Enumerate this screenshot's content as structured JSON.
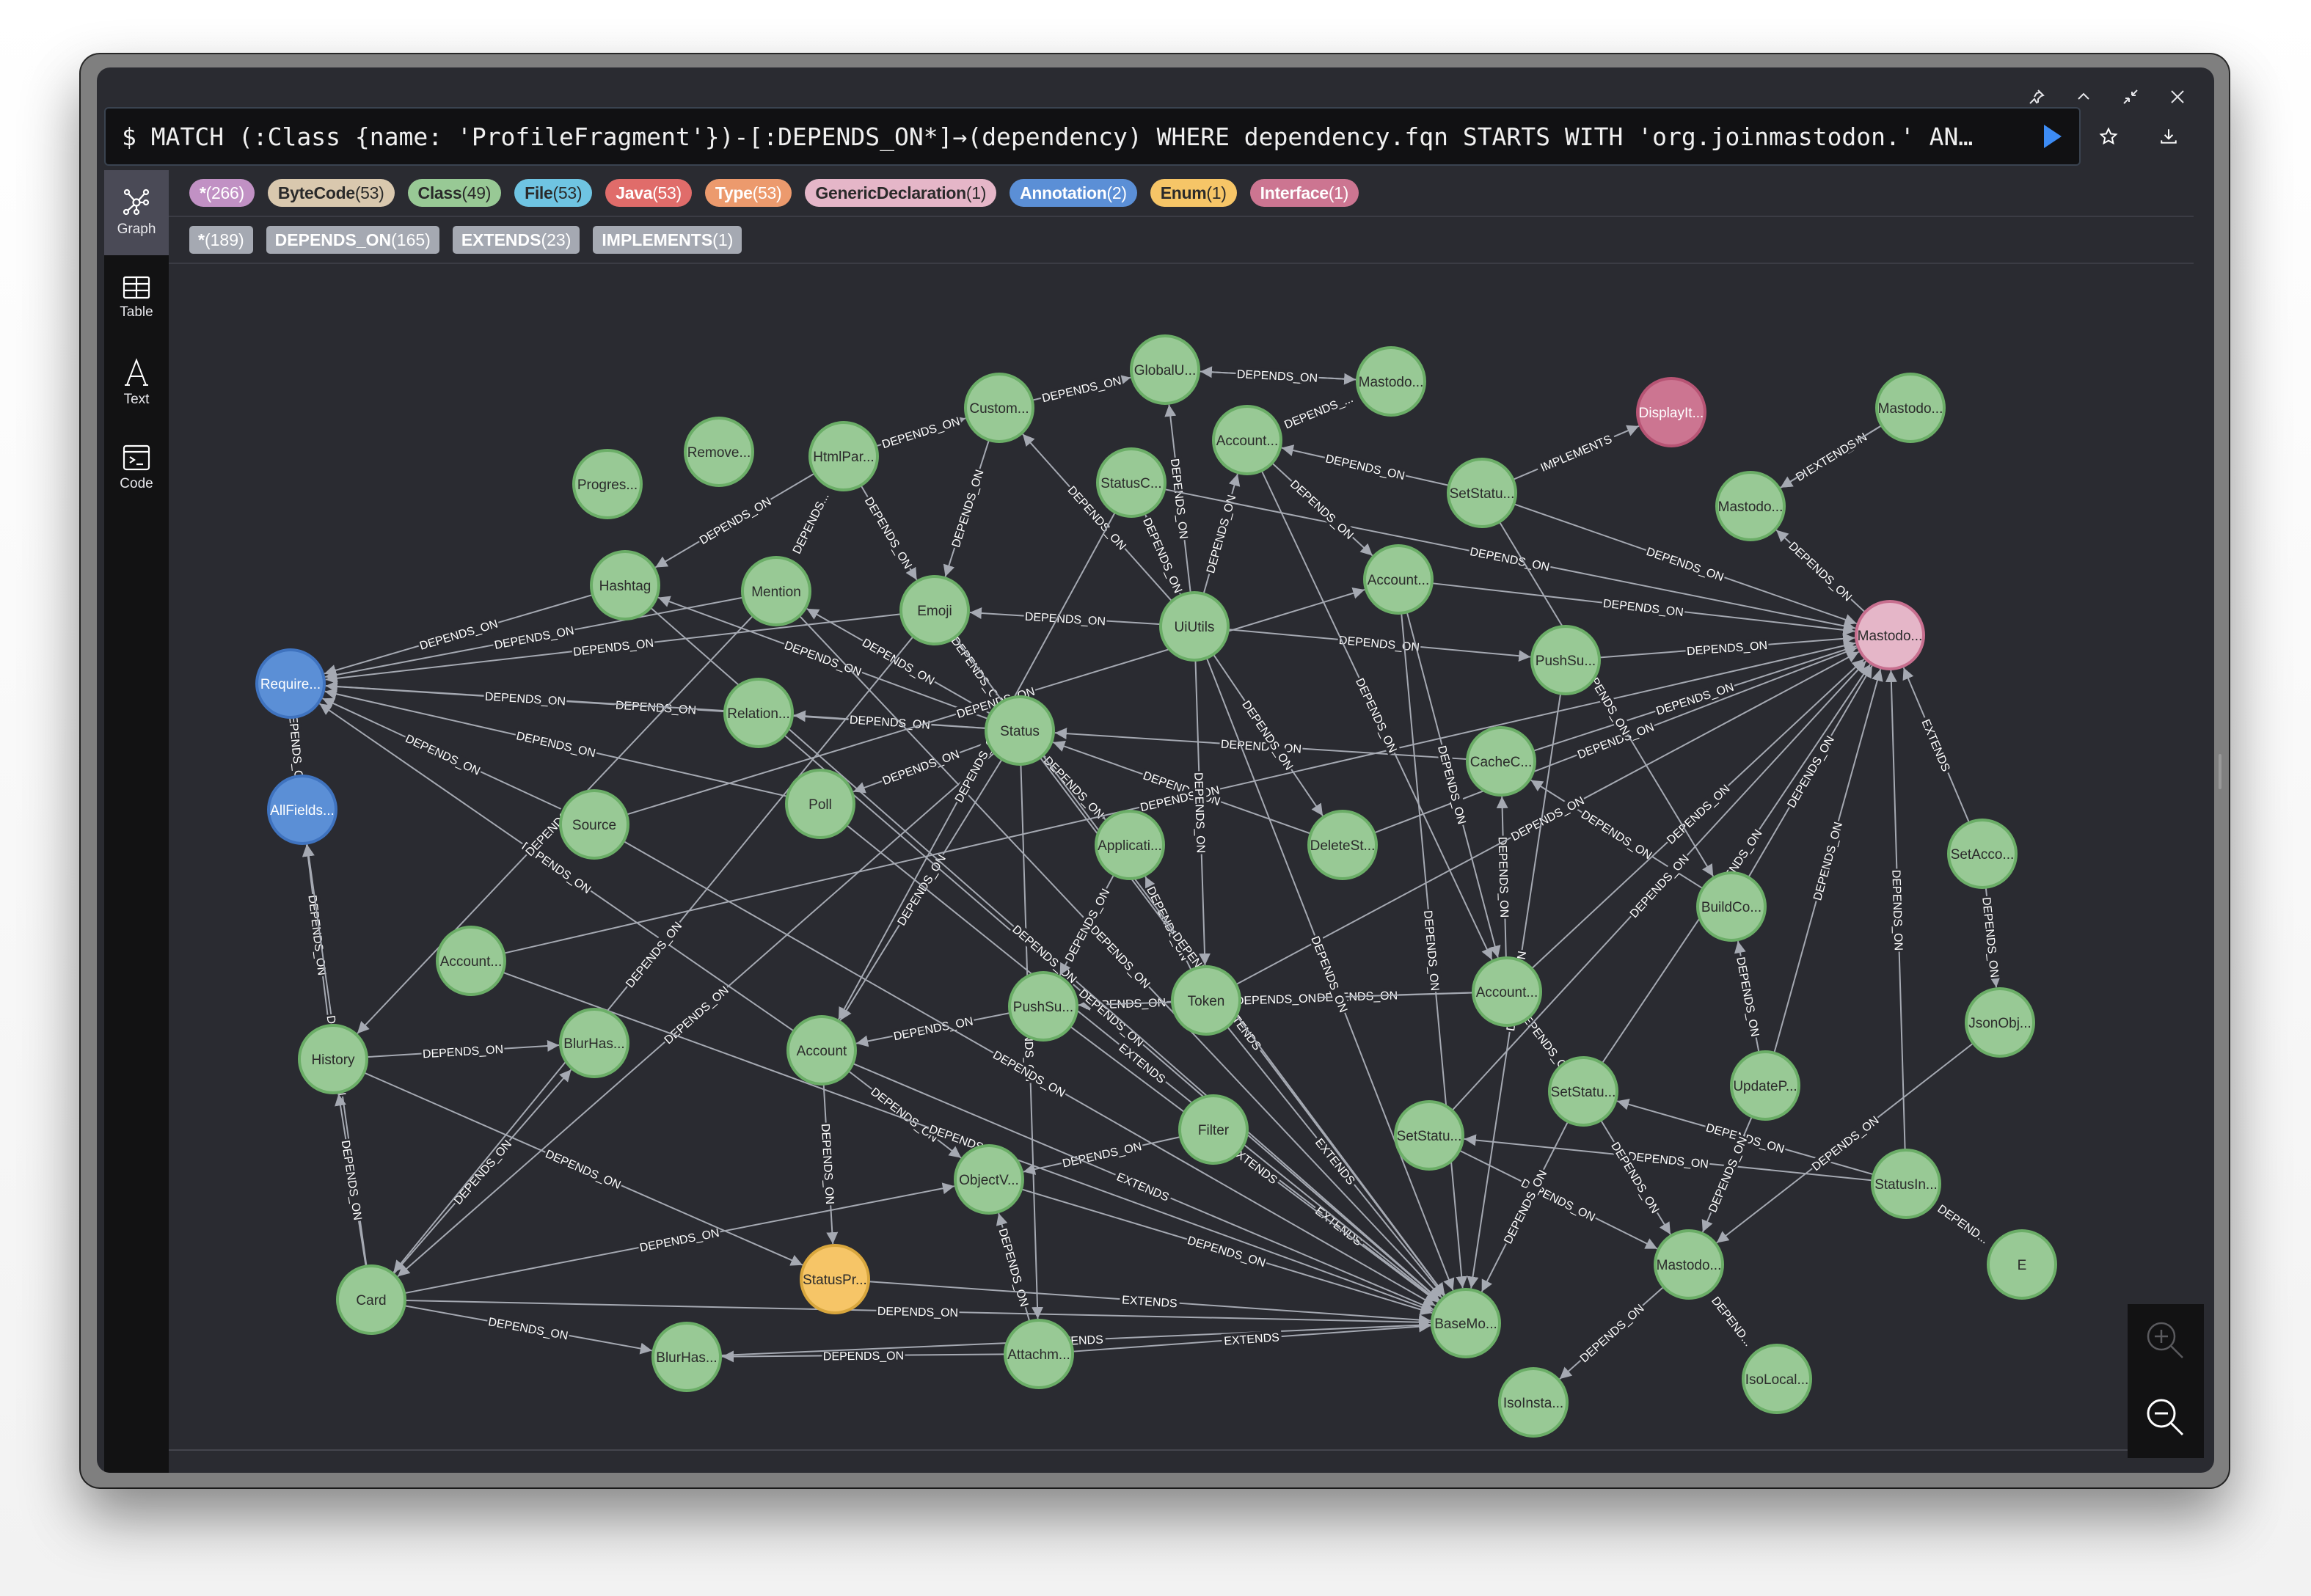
{
  "window_controls": [
    {
      "name": "pin-icon",
      "glyph": "📌"
    },
    {
      "name": "collapse-icon",
      "glyph": "︿"
    },
    {
      "name": "shrink-icon",
      "glyph": "⤡"
    },
    {
      "name": "close-icon",
      "glyph": "✕"
    }
  ],
  "query": {
    "text": "$ MATCH (:Class {name: 'ProfileFragment'})-[:DEPENDS_ON*]→(dependency) WHERE dependency.fqn STARTS WITH 'org.joinmastodon.' AN…",
    "run_icon": "play-icon",
    "favorite_icon": "star-icon",
    "download_icon": "download-icon"
  },
  "sidebar": {
    "items": [
      {
        "label": "Graph",
        "icon": "graph-icon",
        "active": true
      },
      {
        "label": "Table",
        "icon": "table-icon",
        "active": false
      },
      {
        "label": "Text",
        "icon": "text-icon",
        "active": false
      },
      {
        "label": "Code",
        "icon": "code-icon",
        "active": false
      }
    ]
  },
  "node_labels": [
    {
      "label": "*",
      "count": "(266)",
      "bg": "#c191c4",
      "fg": "#ffffff"
    },
    {
      "label": "ByteCode",
      "count": "(53)",
      "bg": "#d9c8ae",
      "fg": "#2a2a2a"
    },
    {
      "label": "Class",
      "count": "(49)",
      "bg": "#98c995",
      "fg": "#2a2a2a"
    },
    {
      "label": "File",
      "count": "(53)",
      "bg": "#6fc4e2",
      "fg": "#2a2a2a"
    },
    {
      "label": "Java",
      "count": "(53)",
      "bg": "#e06c6a",
      "fg": "#ffffff"
    },
    {
      "label": "Type",
      "count": "(53)",
      "bg": "#ec9a6d",
      "fg": "#ffffff"
    },
    {
      "label": "GenericDeclaration",
      "count": "(1)",
      "bg": "#e5b6c8",
      "fg": "#2a2a2a"
    },
    {
      "label": "Annotation",
      "count": "(2)",
      "bg": "#5b8fd6",
      "fg": "#ffffff"
    },
    {
      "label": "Enum",
      "count": "(1)",
      "bg": "#f6c567",
      "fg": "#2a2a2a"
    },
    {
      "label": "Interface",
      "count": "(1)",
      "bg": "#cc7591",
      "fg": "#ffffff"
    }
  ],
  "relationship_types": [
    {
      "label": "*",
      "count": "(189)"
    },
    {
      "label": "DEPENDS_ON",
      "count": "(165)"
    },
    {
      "label": "EXTENDS",
      "count": "(23)"
    },
    {
      "label": "IMPLEMENTS",
      "count": "(1)"
    }
  ],
  "node_styles": {
    "class": {
      "fill": "#98c995",
      "stroke": "#6bae67",
      "text": "#2b2b2b"
    },
    "annotation": {
      "fill": "#5b8fd6",
      "stroke": "#3f73bf",
      "text": "#ffffff"
    },
    "interface": {
      "fill": "#cc7591",
      "stroke": "#b75474",
      "text": "#ffffff"
    },
    "generic": {
      "fill": "#e5b6c8",
      "stroke": "#c86f8f",
      "text": "#2b2b2b"
    },
    "enum": {
      "fill": "#f6c567",
      "stroke": "#d8a63d",
      "text": "#2b2b2b"
    }
  },
  "graph": {
    "nodes": [
      {
        "id": "progres",
        "label": "Progres...",
        "type": "class"
      },
      {
        "id": "remove",
        "label": "Remove...",
        "type": "class"
      },
      {
        "id": "htmlpar",
        "label": "HtmlPar...",
        "type": "class"
      },
      {
        "id": "custom",
        "label": "Custom...",
        "type": "class"
      },
      {
        "id": "globalu",
        "label": "GlobalU...",
        "type": "class"
      },
      {
        "id": "mastodo1",
        "label": "Mastodo...",
        "type": "class"
      },
      {
        "id": "displayit",
        "label": "DisplayIt...",
        "type": "interface"
      },
      {
        "id": "mastodo2",
        "label": "Mastodo...",
        "type": "class"
      },
      {
        "id": "mastodo3",
        "label": "Mastodo...",
        "type": "class"
      },
      {
        "id": "account1",
        "label": "Account...",
        "type": "class"
      },
      {
        "id": "statusc",
        "label": "StatusC...",
        "type": "class"
      },
      {
        "id": "setstatu1",
        "label": "SetStatu...",
        "type": "class"
      },
      {
        "id": "hashtag",
        "label": "Hashtag",
        "type": "class"
      },
      {
        "id": "mention",
        "label": "Mention",
        "type": "class"
      },
      {
        "id": "emoji",
        "label": "Emoji",
        "type": "class"
      },
      {
        "id": "uiutils",
        "label": "UiUtils",
        "type": "class"
      },
      {
        "id": "account2",
        "label": "Account...",
        "type": "class"
      },
      {
        "id": "mastodogen",
        "label": "Mastodo...",
        "type": "generic"
      },
      {
        "id": "pushsu1",
        "label": "PushSu...",
        "type": "class"
      },
      {
        "id": "require",
        "label": "Require...",
        "type": "annotation"
      },
      {
        "id": "relation",
        "label": "Relation...",
        "type": "class"
      },
      {
        "id": "status",
        "label": "Status",
        "type": "class"
      },
      {
        "id": "cachec",
        "label": "CacheC...",
        "type": "class"
      },
      {
        "id": "allfields",
        "label": "AllFields...",
        "type": "annotation"
      },
      {
        "id": "poll",
        "label": "Poll",
        "type": "class"
      },
      {
        "id": "source",
        "label": "Source",
        "type": "class"
      },
      {
        "id": "applicati",
        "label": "Applicati...",
        "type": "class"
      },
      {
        "id": "deletest",
        "label": "DeleteSt...",
        "type": "class"
      },
      {
        "id": "setacco",
        "label": "SetAcco...",
        "type": "class"
      },
      {
        "id": "buildco",
        "label": "BuildCo...",
        "type": "class"
      },
      {
        "id": "account3",
        "label": "Account...",
        "type": "class"
      },
      {
        "id": "pushsu2",
        "label": "PushSu...",
        "type": "class"
      },
      {
        "id": "token",
        "label": "Token",
        "type": "class"
      },
      {
        "id": "account4",
        "label": "Account...",
        "type": "class"
      },
      {
        "id": "jsonobj",
        "label": "JsonObj...",
        "type": "class"
      },
      {
        "id": "history",
        "label": "History",
        "type": "class"
      },
      {
        "id": "blurhas1",
        "label": "BlurHas...",
        "type": "class"
      },
      {
        "id": "account",
        "label": "Account",
        "type": "class"
      },
      {
        "id": "setstatu2",
        "label": "SetStatu...",
        "type": "class"
      },
      {
        "id": "updatep",
        "label": "UpdateP...",
        "type": "class"
      },
      {
        "id": "filter",
        "label": "Filter",
        "type": "class"
      },
      {
        "id": "setstatu3",
        "label": "SetStatu...",
        "type": "class"
      },
      {
        "id": "statusin",
        "label": "StatusIn...",
        "type": "class"
      },
      {
        "id": "objectv",
        "label": "ObjectV...",
        "type": "class"
      },
      {
        "id": "statuspr",
        "label": "StatusPr...",
        "type": "enum"
      },
      {
        "id": "mastodo4",
        "label": "Mastodo...",
        "type": "class"
      },
      {
        "id": "e",
        "label": "E",
        "type": "class"
      },
      {
        "id": "card",
        "label": "Card",
        "type": "class"
      },
      {
        "id": "basemo",
        "label": "BaseMo...",
        "type": "class"
      },
      {
        "id": "blurhas2",
        "label": "BlurHas...",
        "type": "class"
      },
      {
        "id": "attachm",
        "label": "Attachm...",
        "type": "class"
      },
      {
        "id": "isolocal",
        "label": "IsoLocal...",
        "type": "class"
      },
      {
        "id": "isoinsta",
        "label": "IsoInsta...",
        "type": "class"
      }
    ],
    "edges": [
      [
        "custom",
        "globalu",
        "DEPENDS_ON"
      ],
      [
        "mastodo1",
        "globalu",
        "DEPENDS_ON"
      ],
      [
        "globalu",
        "mastodo1",
        "DEPENDS_ON"
      ],
      [
        "account1",
        "mastodo1",
        "DEPENDS_..."
      ],
      [
        "htmlpar",
        "custom",
        "DEPENDS_ON"
      ],
      [
        "htmlpar",
        "hashtag",
        "DEPENDS_ON"
      ],
      [
        "htmlpar",
        "mention",
        "DEPENDS..."
      ],
      [
        "htmlpar",
        "emoji",
        "DEPENDS_ON"
      ],
      [
        "custom",
        "emoji",
        "DEPENDS_ON"
      ],
      [
        "uiutils",
        "emoji",
        "DEPENDS_ON"
      ],
      [
        "uiutils",
        "globalu",
        "DEPENDS_ON"
      ],
      [
        "uiutils",
        "custom",
        "DEPENDS_ON"
      ],
      [
        "uiutils",
        "statusc",
        "DEPENDS_ON"
      ],
      [
        "uiutils",
        "account1",
        "DEPENDS_ON"
      ],
      [
        "uiutils",
        "pushsu1",
        "DEPENDS_ON"
      ],
      [
        "setstatu1",
        "displayit",
        "IMPLEMENTS"
      ],
      [
        "setstatu1",
        "account1",
        "DEPENDS_ON"
      ],
      [
        "setstatu1",
        "mastodogen",
        "DEPENDS_ON"
      ],
      [
        "mastodo3",
        "mastodo2",
        "DEPENDS_ON"
      ],
      [
        "mastodo3",
        "mastodo2",
        "EXTENDS"
      ],
      [
        "mastodogen",
        "mastodo2",
        "DEPENDS_ON"
      ],
      [
        "setacco",
        "mastodogen",
        "EXTENDS"
      ],
      [
        "setacco",
        "jsonobj",
        "DEPENDS_ON"
      ],
      [
        "pushsu1",
        "mastodogen",
        "DEPENDS_ON"
      ],
      [
        "account2",
        "mastodogen",
        "DEPENDS_ON"
      ],
      [
        "hashtag",
        "require",
        "DEPENDS_ON"
      ],
      [
        "emoji",
        "require",
        "DEPENDS_ON"
      ],
      [
        "mention",
        "require",
        "DEPENDS_ON"
      ],
      [
        "status",
        "require",
        "DEPENDS_ON"
      ],
      [
        "relation",
        "require",
        "DEPENDS_ON"
      ],
      [
        "poll",
        "require",
        "DEPENDS_ON"
      ],
      [
        "source",
        "require",
        "DEPENDS_ON"
      ],
      [
        "account",
        "require",
        "DEPENDS_ON"
      ],
      [
        "allfields",
        "require",
        "DEPENDS_ON"
      ],
      [
        "history",
        "allfields",
        "DEPENDS_ON"
      ],
      [
        "card",
        "allfields",
        "DEPENDS_ON"
      ],
      [
        "status",
        "relation",
        "DEPENDS_ON"
      ],
      [
        "status",
        "poll",
        "DEPENDS_ON"
      ],
      [
        "status",
        "applicati",
        "DEPENDS_ON"
      ],
      [
        "status",
        "emoji",
        "DEPENDS_ON"
      ],
      [
        "status",
        "mention",
        "DEPENDS_ON"
      ],
      [
        "status",
        "hashtag",
        "DEPENDS_ON"
      ],
      [
        "status",
        "card",
        "DEPENDS_ON"
      ],
      [
        "status",
        "attachm",
        "DEPENDS_ON"
      ],
      [
        "status",
        "account",
        "DEPENDS_ON"
      ],
      [
        "cachec",
        "status",
        "DEPENDS_ON"
      ],
      [
        "deletest",
        "status",
        "DEPENDS_ON"
      ],
      [
        "uiutils",
        "deletest",
        "DEPENDS_ON"
      ],
      [
        "token",
        "applicati",
        "DEPENDS_ON"
      ],
      [
        "account3",
        "token",
        "DEPENDS_ON"
      ],
      [
        "token",
        "pushsu2",
        "DEPENDS_ON"
      ],
      [
        "account3",
        "pushsu2",
        "DEPENDS_ON"
      ],
      [
        "pushsu2",
        "account",
        "DEPENDS_ON"
      ],
      [
        "account3",
        "cachec",
        "DEPENDS_ON"
      ],
      [
        "buildco",
        "cachec",
        "DEPENDS_ON"
      ],
      [
        "updatep",
        "buildco",
        "DEPENDS_ON"
      ],
      [
        "setstatu2",
        "account3",
        "DEPENDS_ON"
      ],
      [
        "statusin",
        "setstatu2",
        "DEPENDS_ON"
      ],
      [
        "statusin",
        "setstatu3",
        "DEPENDS_ON"
      ],
      [
        "statusin",
        "e",
        "DEPEND..."
      ],
      [
        "mastodo4",
        "isoinsta",
        "DEPENDS_ON"
      ],
      [
        "mastodo4",
        "isolocal",
        "DEPEND..."
      ],
      [
        "setstatu2",
        "mastodo4",
        "DEPENDS_ON"
      ],
      [
        "updatep",
        "mastodo4",
        "DEPENDS_ON"
      ],
      [
        "jsonobj",
        "mastodo4",
        "DEPENDS_ON"
      ],
      [
        "setstatu3",
        "mastodo4",
        "DEPENDS_ON"
      ],
      [
        "filter",
        "objectv",
        "DEPENDS_ON"
      ],
      [
        "account",
        "objectv",
        "DEPENDS_ON"
      ],
      [
        "attachm",
        "objectv",
        "DEPENDS_ON"
      ],
      [
        "card",
        "objectv",
        "DEPENDS_ON"
      ],
      [
        "card",
        "blurhas2",
        "DEPENDS_ON"
      ],
      [
        "attachm",
        "blurhas2",
        "DEPENDS_ON"
      ],
      [
        "card",
        "blurhas1",
        "DEPENDS_ON"
      ],
      [
        "source",
        "account2",
        "DEPENDS_ON"
      ],
      [
        "account",
        "statuspr",
        "DEPENDS_ON"
      ],
      [
        "history",
        "statuspr",
        "DEPENDS_ON"
      ],
      [
        "statuspr",
        "basemo",
        "EXTENDS"
      ],
      [
        "blurhas2",
        "basemo",
        "EXTENDS"
      ],
      [
        "attachm",
        "basemo",
        "EXTENDS"
      ],
      [
        "card",
        "basemo",
        "DEPENDS_ON"
      ],
      [
        "filter",
        "basemo",
        "EXTENDS"
      ],
      [
        "token",
        "basemo",
        "EXTENDS"
      ],
      [
        "account",
        "basemo",
        "EXTENDS"
      ],
      [
        "pushsu2",
        "basemo",
        "EXTENDS"
      ],
      [
        "objectv",
        "basemo",
        "DEPENDS_ON"
      ],
      [
        "status",
        "basemo",
        "EXTENDS"
      ],
      [
        "poll",
        "basemo",
        "EXTENDS"
      ],
      [
        "source",
        "basemo",
        "DEPENDS_ON"
      ],
      [
        "relation",
        "basemo",
        "DEPENDS_ON"
      ],
      [
        "account2",
        "basemo",
        "DEPENDS_ON"
      ],
      [
        "setstatu2",
        "basemo",
        "DEPENDS_ON"
      ],
      [
        "emoji",
        "basemo",
        "DEPENDS_ON"
      ],
      [
        "hashtag",
        "basemo",
        "DEPENDS_ON"
      ],
      [
        "mention",
        "basemo",
        "DEPENDS_ON"
      ],
      [
        "history",
        "blurhas1",
        "DEPENDS_ON"
      ],
      [
        "card",
        "history",
        "DEPENDS_ON"
      ],
      [
        "account4",
        "mastodogen",
        "DEPENDS_ON"
      ],
      [
        "buildco",
        "mastodogen",
        "DEPENDS_ON"
      ],
      [
        "updatep",
        "mastodogen",
        "DEPENDS_ON"
      ],
      [
        "statusin",
        "mastodogen",
        "DEPENDS_ON"
      ],
      [
        "setstatu2",
        "mastodogen",
        "DEPENDS_ON"
      ],
      [
        "cachec",
        "mastodogen",
        "DEPENDS_ON"
      ],
      [
        "account3",
        "mastodogen",
        "DEPENDS_ON"
      ],
      [
        "token",
        "mastodogen",
        "DEPENDS_ON"
      ],
      [
        "setstatu3",
        "mastodogen",
        "DEPENDS_ON"
      ],
      [
        "statusc",
        "mastodogen",
        "DEPENDS_ON"
      ],
      [
        "deletest",
        "mastodogen",
        "DEPENDS_ON"
      ],
      [
        "account1",
        "account2",
        "DEPENDS_ON"
      ],
      [
        "account2",
        "account3",
        "DEPENDS_ON"
      ],
      [
        "account1",
        "account3",
        "DEPENDS_ON"
      ],
      [
        "setstatu1",
        "buildco",
        "DEPENDS_ON"
      ],
      [
        "uiutils",
        "token",
        "DEPENDS_ON"
      ],
      [
        "applicati",
        "pushsu2",
        "DEPENDS_ON"
      ],
      [
        "statusc",
        "account",
        "DEPENDS_ON"
      ],
      [
        "mention",
        "history",
        "DEPENDS_ON"
      ],
      [
        "uiutils",
        "basemo",
        "DEPENDS_ON"
      ],
      [
        "pushsu1",
        "basemo",
        "DEPENDS_ON"
      ],
      [
        "account4",
        "basemo",
        "DEPENDS_ON"
      ],
      [
        "emoji",
        "card",
        "DEPENDS_ON"
      ]
    ]
  },
  "zoom_controls": {
    "zoom_in_icon": "zoom-in-icon",
    "zoom_out_icon": "zoom-out-icon"
  }
}
